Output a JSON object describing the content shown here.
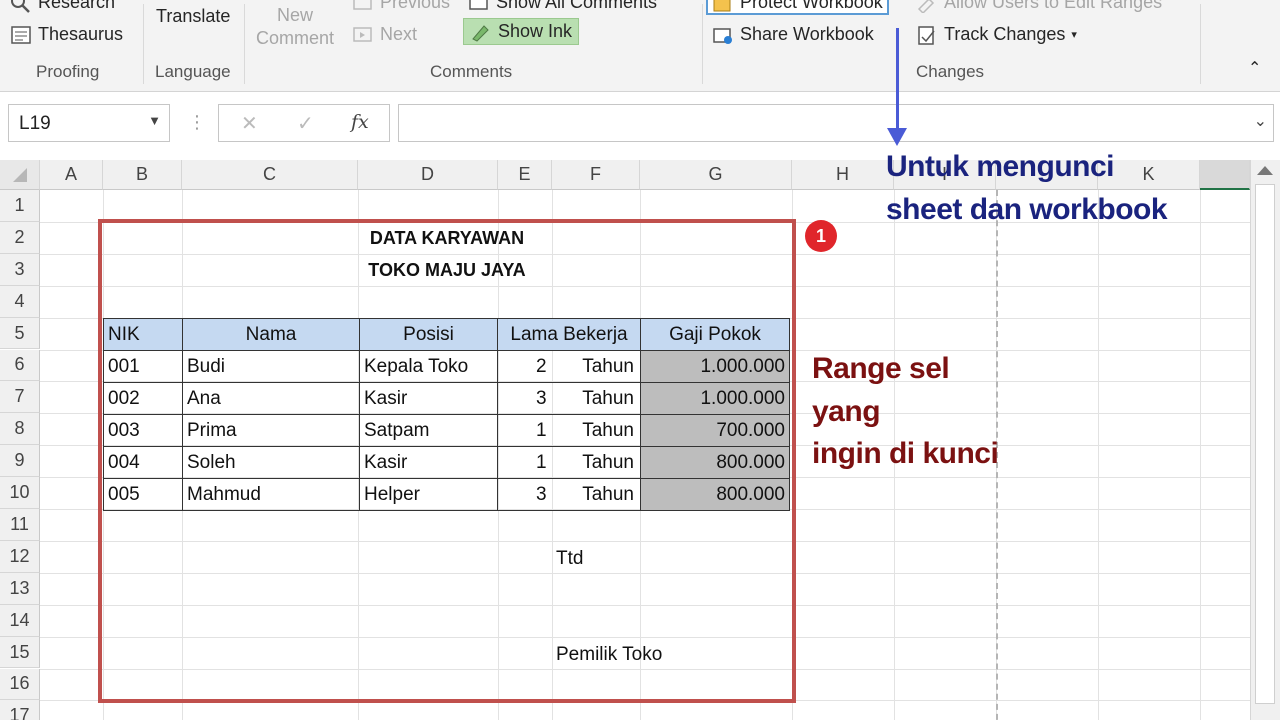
{
  "ribbon": {
    "research_label": "Research",
    "thesaurus_label": "Thesaurus",
    "translate_label": "Translate",
    "new_comment_label_1": "New",
    "new_comment_label_2": "Comment",
    "previous_label": "Previous",
    "next_label": "Next",
    "show_all_comments_label": "Show All Comments",
    "show_ink_label": "Show Ink",
    "protect_workbook_label": "Protect Workbook",
    "share_workbook_label": "Share Workbook",
    "allow_users_label": "Allow Users to Edit Ranges",
    "track_changes_label": "Track Changes",
    "groups": {
      "proofing": "Proofing",
      "language": "Language",
      "comments": "Comments",
      "changes": "Changes"
    }
  },
  "formula_bar": {
    "name_box": "L19",
    "fx_label": "fx",
    "value": ""
  },
  "grid": {
    "columns": [
      "A",
      "B",
      "C",
      "D",
      "E",
      "F",
      "G",
      "H",
      "I",
      "K"
    ],
    "rows": [
      "1",
      "2",
      "3",
      "4",
      "5",
      "6",
      "7",
      "8",
      "9",
      "10",
      "11",
      "12",
      "13",
      "14",
      "15",
      "16",
      "17"
    ]
  },
  "sheet": {
    "title_1": "DATA KARYAWAN",
    "title_2": "TOKO MAJU JAYA",
    "headers": [
      "NIK",
      "Nama",
      "Posisi",
      "Lama Bekerja",
      "Gaji Pokok"
    ],
    "rows": [
      {
        "nik": "001",
        "nama": "Budi",
        "posisi": "Kepala Toko",
        "lama": "2",
        "satuan": "Tahun",
        "gaji": "1.000.000"
      },
      {
        "nik": "002",
        "nama": "Ana",
        "posisi": "Kasir",
        "lama": "3",
        "satuan": "Tahun",
        "gaji": "1.000.000"
      },
      {
        "nik": "003",
        "nama": "Prima",
        "posisi": "Satpam",
        "lama": "1",
        "satuan": "Tahun",
        "gaji": "700.000"
      },
      {
        "nik": "004",
        "nama": "Soleh",
        "posisi": "Kasir",
        "lama": "1",
        "satuan": "Tahun",
        "gaji": "800.000"
      },
      {
        "nik": "005",
        "nama": "Mahmud",
        "posisi": "Helper",
        "lama": "3",
        "satuan": "Tahun",
        "gaji": "800.000"
      }
    ],
    "ttd": "Ttd",
    "pemilik": "Pemilik Toko"
  },
  "annotations": {
    "badge": "1",
    "lock_note_1": "Untuk mengunci",
    "lock_note_2": "sheet dan workbook",
    "range_note_1": "Range sel",
    "range_note_2": "yang",
    "range_note_3": "ingin di kunci",
    "range_box_color": "#c0504d",
    "arrow_color": "#4a5bd6"
  }
}
